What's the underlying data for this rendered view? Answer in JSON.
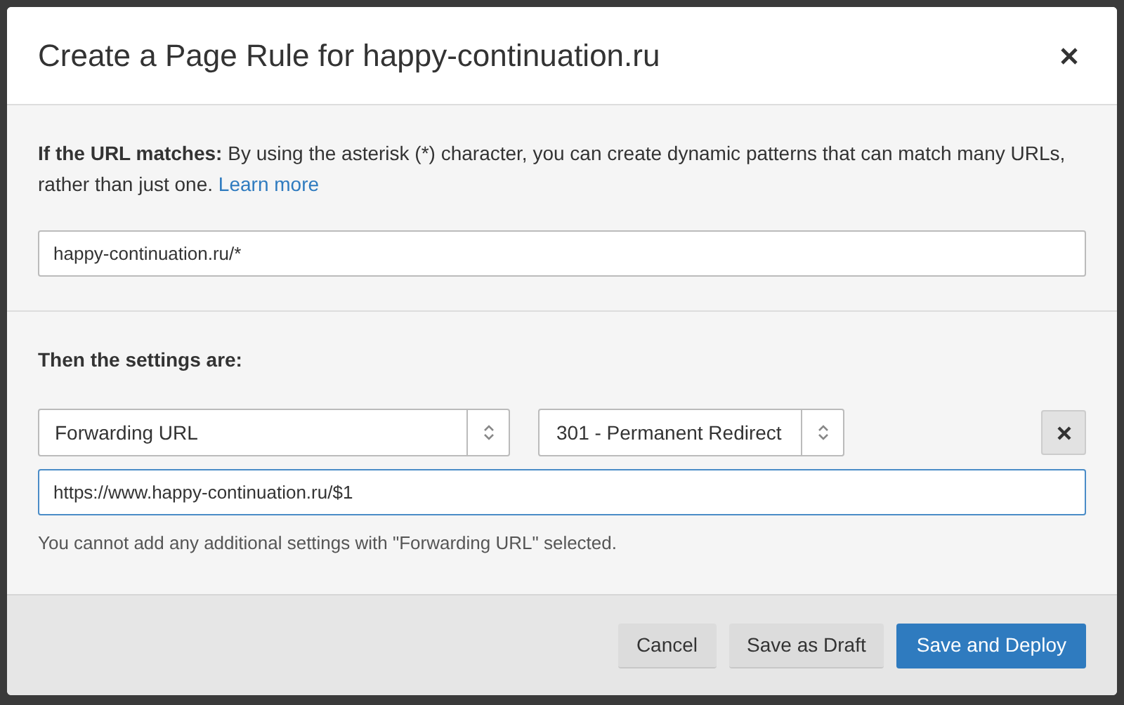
{
  "dialog": {
    "title": "Create a Page Rule for happy-continuation.ru"
  },
  "url_section": {
    "label": "If the URL matches:",
    "description": "By using the asterisk (*) character, you can create dynamic patterns that can match many URLs, rather than just one.",
    "link": "Learn more",
    "value": "happy-continuation.ru/*"
  },
  "settings_section": {
    "label": "Then the settings are:",
    "setting": "Forwarding URL",
    "status_code": "301 - Permanent Redirect",
    "destination": "https://www.happy-continuation.ru/$1",
    "destination_focused": true,
    "note": "You cannot add any additional settings with \"Forwarding URL\" selected."
  },
  "buttons": [
    {
      "label": "Cancel",
      "kind": "secondary"
    },
    {
      "label": "Save as Draft",
      "kind": "secondary"
    },
    {
      "label": "Save and Deploy",
      "kind": "primary"
    }
  ]
}
